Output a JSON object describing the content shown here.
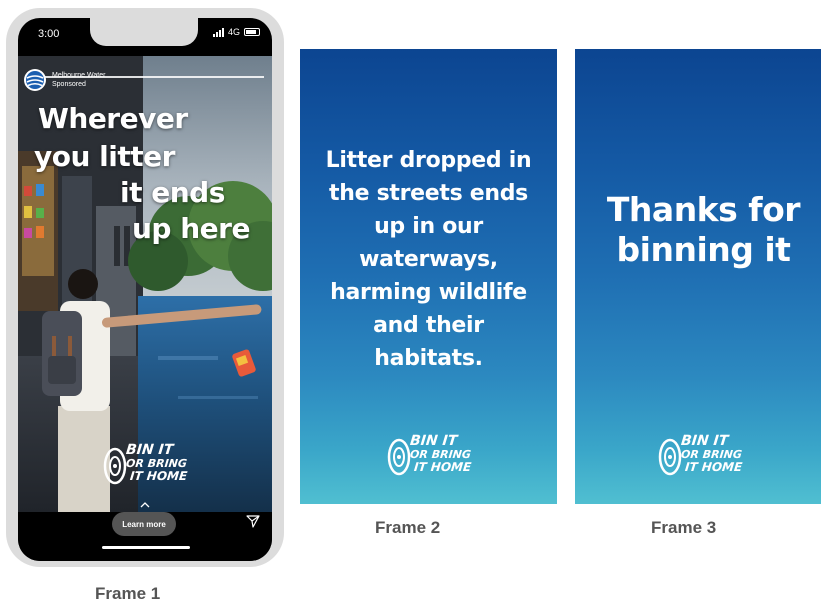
{
  "frame1": {
    "caption": "Frame 1",
    "status": {
      "time": "3:00",
      "network": "4G"
    },
    "advertiser": {
      "name": "Melbourne Water",
      "label": "Sponsored"
    },
    "headline": [
      "Wherever",
      "you litter",
      "it ends",
      "up here"
    ],
    "cta": "Learn more",
    "logo_lines": [
      "BIN IT",
      "OR BRING",
      "IT HOME"
    ]
  },
  "frame2": {
    "caption": "Frame 2",
    "text": "Litter dropped in the streets ends up in our waterways, harming wildlife and their habitats.",
    "logo_lines": [
      "BIN IT",
      "OR BRING",
      "IT HOME"
    ]
  },
  "frame3": {
    "caption": "Frame 3",
    "text": "Thanks for binning it",
    "logo_lines": [
      "BIN IT",
      "OR BRING",
      "IT HOME"
    ]
  },
  "colors": {
    "gradient_top": "#0c4591",
    "gradient_bottom": "#50bfd1",
    "phone_bezel": "#dcdcdc",
    "caption": "#555555"
  }
}
